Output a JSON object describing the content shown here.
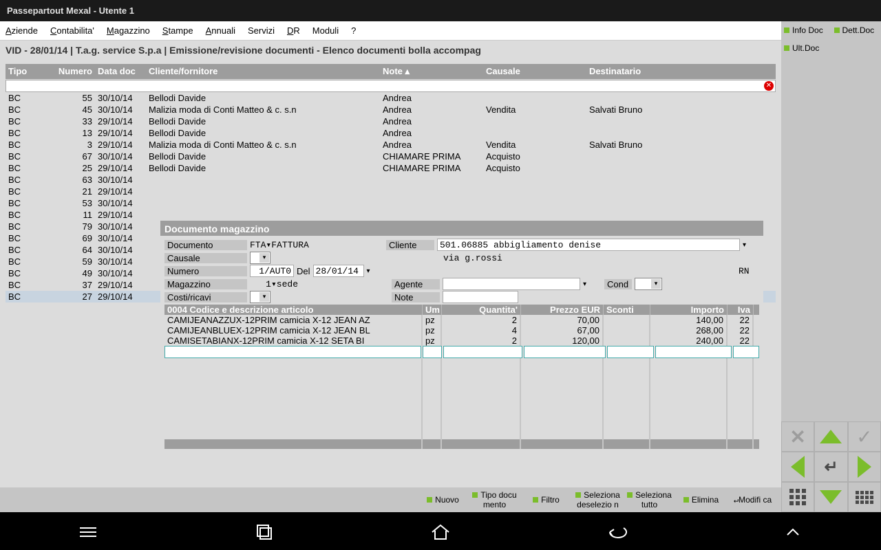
{
  "title": "Passepartout Mexal - Utente 1",
  "menu": [
    "Aziende",
    "Contabilita'",
    "Magazzino",
    "Stampe",
    "Annuali",
    "Servizi",
    "DR",
    "Moduli",
    "?"
  ],
  "menu_ul": [
    "A",
    "C",
    "M",
    "S",
    "A",
    "",
    "D",
    "",
    ""
  ],
  "breadcrumb": "VID - 28/01/14 | T.a.g. service S.p.a  | Emissione/revisione documenti - Elenco documenti bolla accompag",
  "columns": {
    "tipo": "Tipo",
    "numero": "Numero",
    "data": "Data doc",
    "cliente": "Cliente/fornitore",
    "note": "Note ▴",
    "causale": "Causale",
    "dest": "Destinatario"
  },
  "rows": [
    {
      "tipo": "BC",
      "num": "55",
      "data": "30/10/14",
      "cli": "Bellodi Davide",
      "note": "Andrea",
      "caus": "",
      "dest": ""
    },
    {
      "tipo": "BC",
      "num": "45",
      "data": "30/10/14",
      "cli": "Malizia moda di Conti Matteo & c. s.n",
      "note": "Andrea",
      "caus": "Vendita",
      "dest": "Salvati Bruno"
    },
    {
      "tipo": "BC",
      "num": "33",
      "data": "29/10/14",
      "cli": "Bellodi Davide",
      "note": "Andrea",
      "caus": "",
      "dest": ""
    },
    {
      "tipo": "BC",
      "num": "13",
      "data": "29/10/14",
      "cli": "Bellodi Davide",
      "note": "Andrea",
      "caus": "",
      "dest": ""
    },
    {
      "tipo": "BC",
      "num": "3",
      "data": "29/10/14",
      "cli": "Malizia moda di Conti Matteo & c. s.n",
      "note": "Andrea",
      "caus": "Vendita",
      "dest": "Salvati Bruno"
    },
    {
      "tipo": "BC",
      "num": "67",
      "data": "30/10/14",
      "cli": "Bellodi Davide",
      "note": "CHIAMARE PRIMA",
      "caus": "Acquisto",
      "dest": ""
    },
    {
      "tipo": "BC",
      "num": "25",
      "data": "29/10/14",
      "cli": "Bellodi Davide",
      "note": "CHIAMARE PRIMA",
      "caus": "Acquisto",
      "dest": ""
    },
    {
      "tipo": "BC",
      "num": "63",
      "data": "30/10/14",
      "cli": "",
      "note": "",
      "caus": "",
      "dest": ""
    },
    {
      "tipo": "BC",
      "num": "21",
      "data": "29/10/14",
      "cli": "",
      "note": "",
      "caus": "",
      "dest": ""
    },
    {
      "tipo": "BC",
      "num": "53",
      "data": "30/10/14",
      "cli": "",
      "note": "",
      "caus": "",
      "dest": ""
    },
    {
      "tipo": "BC",
      "num": "11",
      "data": "29/10/14",
      "cli": "",
      "note": "",
      "caus": "",
      "dest": ""
    },
    {
      "tipo": "BC",
      "num": "79",
      "data": "30/10/14",
      "cli": "",
      "note": "",
      "caus": "",
      "dest": ""
    },
    {
      "tipo": "BC",
      "num": "69",
      "data": "30/10/14",
      "cli": "",
      "note": "",
      "caus": "",
      "dest": ""
    },
    {
      "tipo": "BC",
      "num": "64",
      "data": "30/10/14",
      "cli": "",
      "note": "",
      "caus": "",
      "dest": ""
    },
    {
      "tipo": "BC",
      "num": "59",
      "data": "30/10/14",
      "cli": "",
      "note": "",
      "caus": "",
      "dest": ""
    },
    {
      "tipo": "BC",
      "num": "49",
      "data": "30/10/14",
      "cli": "",
      "note": "",
      "caus": "",
      "dest": ""
    },
    {
      "tipo": "BC",
      "num": "37",
      "data": "29/10/14",
      "cli": "",
      "note": "",
      "caus": "",
      "dest": ""
    },
    {
      "tipo": "BC",
      "num": "27",
      "data": "29/10/14",
      "cli": "",
      "note": "",
      "caus": "",
      "dest": "",
      "sel": true
    }
  ],
  "popup": {
    "title": "Documento magazzino",
    "labels": {
      "documento": "Documento",
      "causale": "Causale",
      "numero": "Numero",
      "del": "Del",
      "magazzino": "Magazzino",
      "costi": "Costi/ricavi",
      "cliente": "Cliente",
      "agente": "Agente",
      "cond": "Cond",
      "note": "Note"
    },
    "doc_type": "FTA▾FATTURA",
    "numero": "1/AUT0",
    "del": "28/01/14",
    "mag": "1▾sede",
    "cliente_code": "501.06885 abbigliamento denise",
    "cliente_via": "via g.rossi",
    "cliente_prov": "RN",
    "grid_header": {
      "code": "0004   Codice e descrizione articolo",
      "um": "Um",
      "qta": "Quantita'",
      "prz": "Prezzo    EUR",
      "sc": "Sconti",
      "imp": "Importo",
      "iva": "Iva"
    },
    "lines": [
      {
        "code": "CAMIJEANAZZUX-12PRIM camicia X-12 JEAN AZ",
        "um": "pz",
        "qta": "2",
        "prz": "70,00",
        "imp": "140,00",
        "iva": "22"
      },
      {
        "code": "CAMIJEANBLUEX-12PRIM camicia X-12 JEAN BL",
        "um": "pz",
        "qta": "4",
        "prz": "67,00",
        "imp": "268,00",
        "iva": "22"
      },
      {
        "code": "CAMISETABIANX-12PRIM camicia X-12 SETA BI",
        "um": "pz",
        "qta": "2",
        "prz": "120,00",
        "imp": "240,00",
        "iva": "22"
      }
    ]
  },
  "actions": {
    "nuovo": "Nuovo",
    "tipo": "Tipo docu mento",
    "filtro": "Filtro",
    "seldes": "Seleziona deselezio n",
    "seltutto": "Seleziona tutto",
    "elimina": "Elimina",
    "modifica": "Modifi ca"
  },
  "rail": {
    "info": "Info Doc",
    "dett": "Dett.Doc",
    "ult": "Ult.Doc"
  }
}
